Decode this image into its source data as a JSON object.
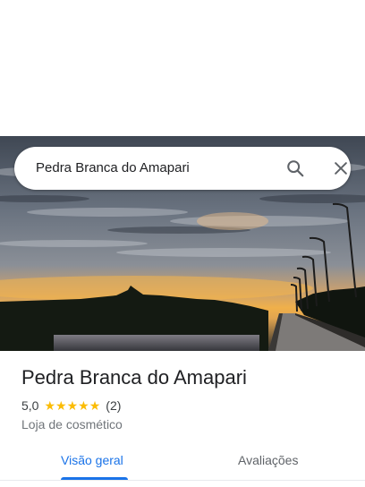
{
  "search": {
    "query": "Pedra Branca do Amapari"
  },
  "place": {
    "name": "Pedra Branca do Amapari",
    "rating": "5,0",
    "stars": 5,
    "review_count": "(2)",
    "category": "Loja de cosmético"
  },
  "tabs": [
    {
      "label": "Visão geral",
      "active": true
    },
    {
      "label": "Avaliações",
      "active": false
    }
  ],
  "colors": {
    "accent": "#1a73e8",
    "star": "#fbbc04",
    "text_primary": "#202124",
    "text_secondary": "#70757a"
  },
  "icons": {
    "search": "search-icon",
    "close": "close-icon",
    "star": "star-icon"
  }
}
